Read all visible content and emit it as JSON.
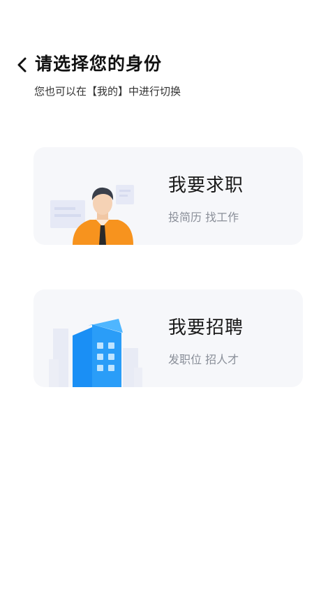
{
  "header": {
    "title": "请选择您的身份",
    "subtitle": "您也可以在【我的】中进行切换"
  },
  "cards": [
    {
      "title": "我要求职",
      "description": "投简历 找工作",
      "icon": "job-seeker-person-icon",
      "accent": "#f7931e"
    },
    {
      "title": "我要招聘",
      "description": "发职位 招人才",
      "icon": "office-building-icon",
      "accent": "#1e90ff"
    }
  ],
  "colors": {
    "card_background": "#f6f7fa",
    "desc_text": "#8a8f99"
  }
}
